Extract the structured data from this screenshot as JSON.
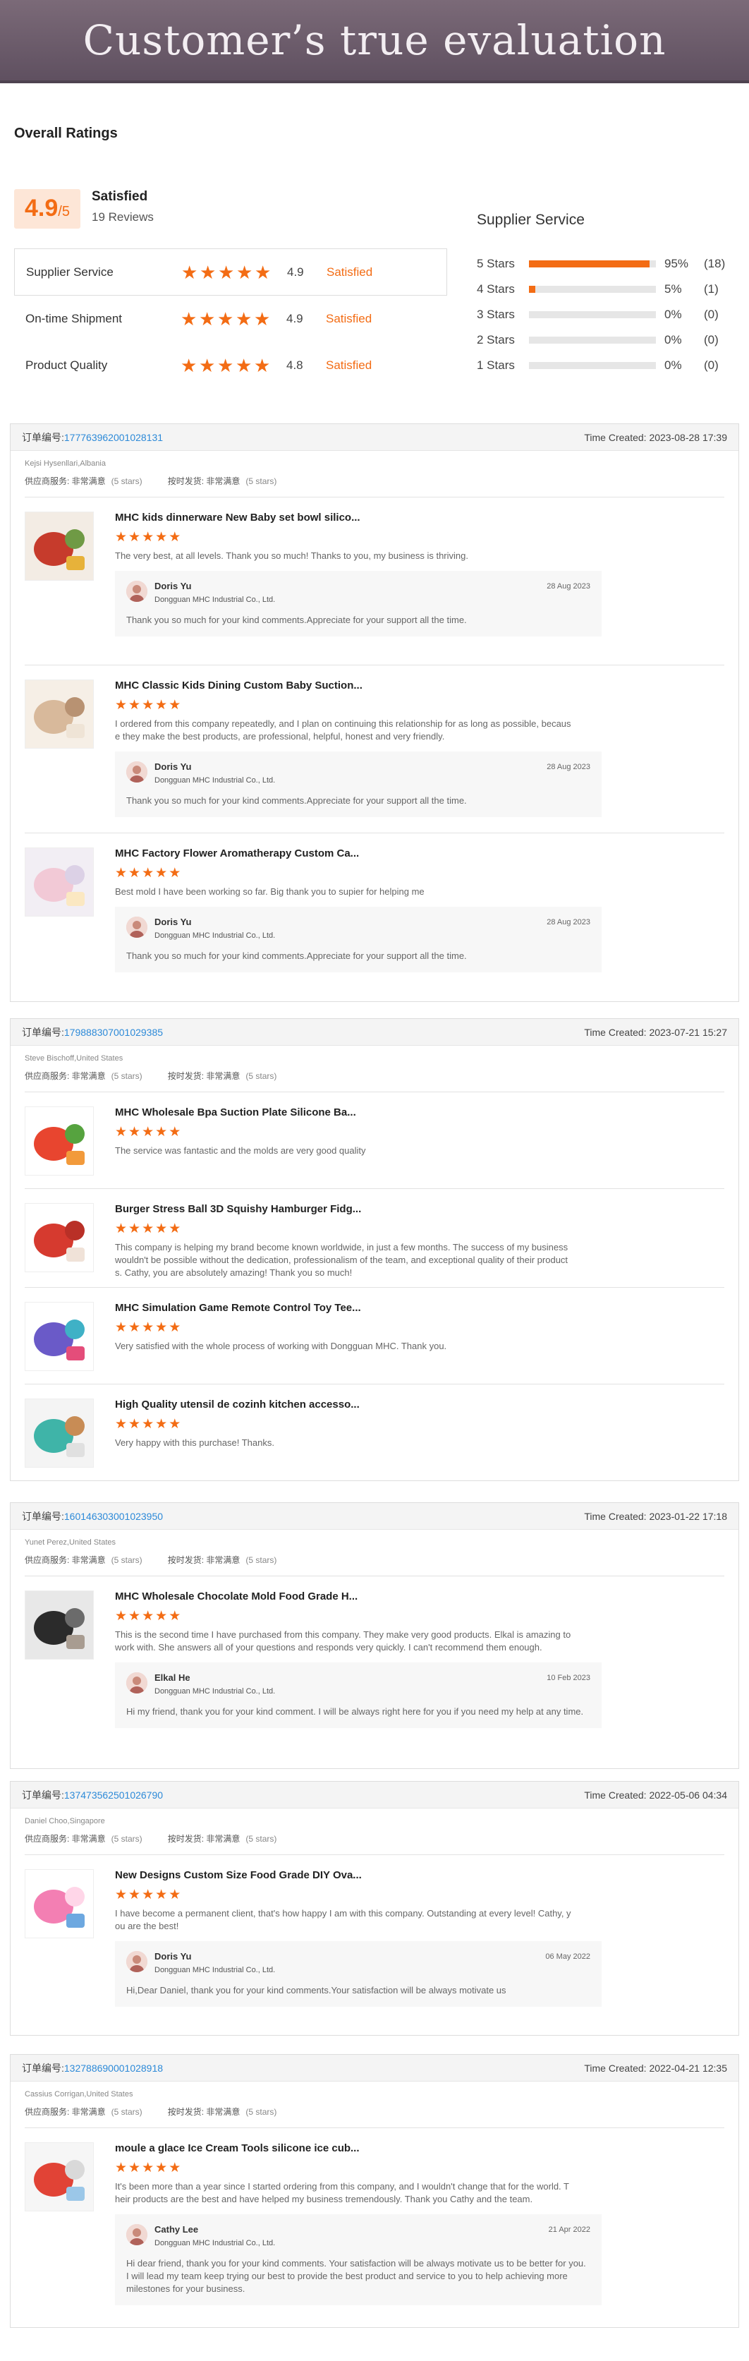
{
  "banner": {
    "title": "Customer’s true evaluation"
  },
  "overall": {
    "title": "Overall Ratings",
    "score": "4.9",
    "score_max": "/5",
    "label": "Satisfied",
    "reviews": "19 Reviews",
    "rows": [
      {
        "label": "Supplier Service",
        "value": "4.9",
        "status": "Satisfied"
      },
      {
        "label": "On-time Shipment",
        "value": "4.9",
        "status": "Satisfied"
      },
      {
        "label": "Product Quality",
        "value": "4.8",
        "status": "Satisfied"
      }
    ]
  },
  "supplier": {
    "title": "Supplier Service",
    "rows": [
      {
        "label": "5 Stars",
        "pct": "95%",
        "count": "(18)",
        "fill": 95
      },
      {
        "label": "4 Stars",
        "pct": "5%",
        "count": "(1)",
        "fill": 5
      },
      {
        "label": "3 Stars",
        "pct": "0%",
        "count": "(0)",
        "fill": 0
      },
      {
        "label": "2 Stars",
        "pct": "0%",
        "count": "(0)",
        "fill": 0
      },
      {
        "label": "1 Stars",
        "pct": "0%",
        "count": "(0)",
        "fill": 0
      }
    ]
  },
  "common": {
    "order_label": "订单编号:",
    "service_tag": "供应商服务: 非常满意",
    "shipment_tag": "按时发货: 非常满意",
    "stars_note": "(5 stars)",
    "time_label": "Time Created:",
    "company": "Dongguan MHC Industrial Co., Ltd."
  },
  "orders": [
    {
      "id": "177763962001028131",
      "time": "2023-08-28 17:39",
      "buyer": "Kejsi Hysenllari,Albania",
      "items": [
        {
          "title": "MHC kids dinnerware New Baby set bowl silico...",
          "text": "The very best, at all levels. Thank you so much! Thanks to you, my business is thriving.",
          "reply": {
            "name": "Doris Yu",
            "date": "28 Aug 2023",
            "text": "Thank you so much for your kind comments.Appreciate for your support all the time."
          }
        },
        {
          "title": "MHC Classic Kids Dining Custom Baby Suction...",
          "text": "I ordered from this company repeatedly, and I plan on continuing this relationship for as long as possible, because they make the best products, are professional, helpful, honest and very friendly.",
          "reply": {
            "name": "Doris Yu",
            "date": "28 Aug 2023",
            "text": "Thank you so much for your kind comments.Appreciate for your support all the time."
          }
        },
        {
          "title": "MHC Factory Flower Aromatherapy Custom Ca...",
          "text": "Best mold I have been working so far. Big thank you to supier for helping me",
          "reply": {
            "name": "Doris Yu",
            "date": "28 Aug 2023",
            "text": "Thank you so much for your kind comments.Appreciate for your support all the time."
          }
        }
      ]
    },
    {
      "id": "179888307001029385",
      "time": "2023-07-21 15:27",
      "buyer": "Steve Bischoff,United States",
      "items": [
        {
          "title": "MHC Wholesale Bpa Suction Plate Silicone Ba...",
          "text": "The service was fantastic and the molds are very good quality"
        },
        {
          "title": "Burger Stress Ball 3D Squishy Hamburger Fidg...",
          "text": "This company is helping my brand become known worldwide, in just a few months. The success of my business wouldn't be possible without the dedication, professionalism of the team, and exceptional quality of their products. Cathy, you are absolutely amazing! Thank you so much!"
        },
        {
          "title": "MHC Simulation Game Remote Control Toy Tee...",
          "text": " Very satisfied with the whole process of working with Dongguan MHC. Thank you."
        },
        {
          "title": "High Quality utensil de cozinh kitchen accesso...",
          "text": " Very happy with this purchase! Thanks."
        }
      ]
    },
    {
      "id": "160146303001023950",
      "time": "2023-01-22 17:18",
      "buyer": "Yunet Perez,United States",
      "items": [
        {
          "title": "MHC Wholesale Chocolate Mold Food Grade H...",
          "text": "This is the second time I have purchased from this company. They make very good products. Elkal is amazing to work with. She answers all of your questions and responds very quickly. I can't recommend them enough.",
          "reply": {
            "name": "Elkal He",
            "date": "10 Feb 2023",
            "text": "Hi my friend, thank you for your kind comment. I will be always right here for you if you need my help at any time."
          }
        }
      ]
    },
    {
      "id": "137473562501026790",
      "time": "2022-05-06 04:34",
      "buyer": "Daniel Choo,Singapore",
      "items": [
        {
          "title": "New Designs Custom Size Food Grade DIY Ova...",
          "text": "I have become a permanent client, that's how happy I am with this company. Outstanding at every level! Cathy, you are the best!",
          "reply": {
            "name": "Doris Yu",
            "date": "06 May 2022",
            "text": "Hi,Dear Daniel, thank you for your kind comments.Your satisfaction will be always motivate us"
          }
        }
      ]
    },
    {
      "id": "132788690001028918",
      "time": "2022-04-21 12:35",
      "buyer": "Cassius Corrigan,United States",
      "items": [
        {
          "title": "moule a glace Ice Cream Tools silicone ice cub...",
          "text": "It's been more than a year since I started ordering from this company, and I wouldn't change that for the world. Their products are the best and have helped my business tremendously. Thank you Cathy and the team.",
          "reply": {
            "name": "Cathy Lee",
            "date": "21 Apr 2022",
            "text": "Hi dear friend, thank you for your kind comments. Your satisfaction will be always motivate us to be better for you.\nI will lead my team keep trying our best to provide the best product and service to you to help achieving more milestones for your business."
          }
        }
      ]
    }
  ],
  "colors": {
    "accent": "#f36c14",
    "link": "#2d8ad8"
  }
}
